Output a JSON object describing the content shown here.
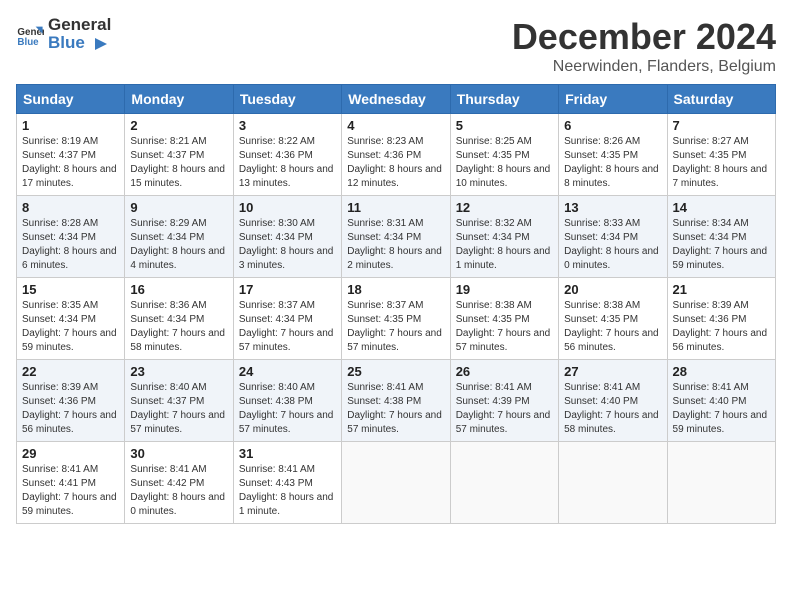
{
  "header": {
    "logo_general": "General",
    "logo_blue": "Blue",
    "month_title": "December 2024",
    "location": "Neerwinden, Flanders, Belgium"
  },
  "days_of_week": [
    "Sunday",
    "Monday",
    "Tuesday",
    "Wednesday",
    "Thursday",
    "Friday",
    "Saturday"
  ],
  "weeks": [
    [
      {
        "day": "1",
        "sunrise": "8:19 AM",
        "sunset": "4:37 PM",
        "daylight": "8 hours and 17 minutes"
      },
      {
        "day": "2",
        "sunrise": "8:21 AM",
        "sunset": "4:37 PM",
        "daylight": "8 hours and 15 minutes"
      },
      {
        "day": "3",
        "sunrise": "8:22 AM",
        "sunset": "4:36 PM",
        "daylight": "8 hours and 13 minutes"
      },
      {
        "day": "4",
        "sunrise": "8:23 AM",
        "sunset": "4:36 PM",
        "daylight": "8 hours and 12 minutes"
      },
      {
        "day": "5",
        "sunrise": "8:25 AM",
        "sunset": "4:35 PM",
        "daylight": "8 hours and 10 minutes"
      },
      {
        "day": "6",
        "sunrise": "8:26 AM",
        "sunset": "4:35 PM",
        "daylight": "8 hours and 8 minutes"
      },
      {
        "day": "7",
        "sunrise": "8:27 AM",
        "sunset": "4:35 PM",
        "daylight": "8 hours and 7 minutes"
      }
    ],
    [
      {
        "day": "8",
        "sunrise": "8:28 AM",
        "sunset": "4:34 PM",
        "daylight": "8 hours and 6 minutes"
      },
      {
        "day": "9",
        "sunrise": "8:29 AM",
        "sunset": "4:34 PM",
        "daylight": "8 hours and 4 minutes"
      },
      {
        "day": "10",
        "sunrise": "8:30 AM",
        "sunset": "4:34 PM",
        "daylight": "8 hours and 3 minutes"
      },
      {
        "day": "11",
        "sunrise": "8:31 AM",
        "sunset": "4:34 PM",
        "daylight": "8 hours and 2 minutes"
      },
      {
        "day": "12",
        "sunrise": "8:32 AM",
        "sunset": "4:34 PM",
        "daylight": "8 hours and 1 minute"
      },
      {
        "day": "13",
        "sunrise": "8:33 AM",
        "sunset": "4:34 PM",
        "daylight": "8 hours and 0 minutes"
      },
      {
        "day": "14",
        "sunrise": "8:34 AM",
        "sunset": "4:34 PM",
        "daylight": "7 hours and 59 minutes"
      }
    ],
    [
      {
        "day": "15",
        "sunrise": "8:35 AM",
        "sunset": "4:34 PM",
        "daylight": "7 hours and 59 minutes"
      },
      {
        "day": "16",
        "sunrise": "8:36 AM",
        "sunset": "4:34 PM",
        "daylight": "7 hours and 58 minutes"
      },
      {
        "day": "17",
        "sunrise": "8:37 AM",
        "sunset": "4:34 PM",
        "daylight": "7 hours and 57 minutes"
      },
      {
        "day": "18",
        "sunrise": "8:37 AM",
        "sunset": "4:35 PM",
        "daylight": "7 hours and 57 minutes"
      },
      {
        "day": "19",
        "sunrise": "8:38 AM",
        "sunset": "4:35 PM",
        "daylight": "7 hours and 57 minutes"
      },
      {
        "day": "20",
        "sunrise": "8:38 AM",
        "sunset": "4:35 PM",
        "daylight": "7 hours and 56 minutes"
      },
      {
        "day": "21",
        "sunrise": "8:39 AM",
        "sunset": "4:36 PM",
        "daylight": "7 hours and 56 minutes"
      }
    ],
    [
      {
        "day": "22",
        "sunrise": "8:39 AM",
        "sunset": "4:36 PM",
        "daylight": "7 hours and 56 minutes"
      },
      {
        "day": "23",
        "sunrise": "8:40 AM",
        "sunset": "4:37 PM",
        "daylight": "7 hours and 57 minutes"
      },
      {
        "day": "24",
        "sunrise": "8:40 AM",
        "sunset": "4:38 PM",
        "daylight": "7 hours and 57 minutes"
      },
      {
        "day": "25",
        "sunrise": "8:41 AM",
        "sunset": "4:38 PM",
        "daylight": "7 hours and 57 minutes"
      },
      {
        "day": "26",
        "sunrise": "8:41 AM",
        "sunset": "4:39 PM",
        "daylight": "7 hours and 57 minutes"
      },
      {
        "day": "27",
        "sunrise": "8:41 AM",
        "sunset": "4:40 PM",
        "daylight": "7 hours and 58 minutes"
      },
      {
        "day": "28",
        "sunrise": "8:41 AM",
        "sunset": "4:40 PM",
        "daylight": "7 hours and 59 minutes"
      }
    ],
    [
      {
        "day": "29",
        "sunrise": "8:41 AM",
        "sunset": "4:41 PM",
        "daylight": "7 hours and 59 minutes"
      },
      {
        "day": "30",
        "sunrise": "8:41 AM",
        "sunset": "4:42 PM",
        "daylight": "8 hours and 0 minutes"
      },
      {
        "day": "31",
        "sunrise": "8:41 AM",
        "sunset": "4:43 PM",
        "daylight": "8 hours and 1 minute"
      },
      null,
      null,
      null,
      null
    ]
  ]
}
